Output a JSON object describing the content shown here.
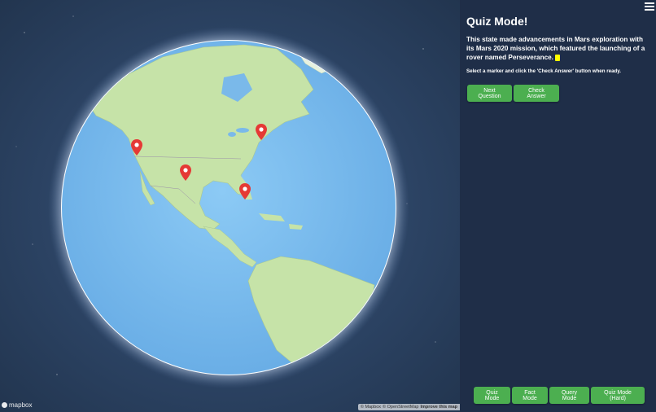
{
  "panel": {
    "title": "Quiz Mode!",
    "question": "This state made advancements in Mars exploration with its Mars 2020 mission, which featured the launching of a rover named Perseverance.",
    "instruction": "Select a marker and click the 'Check Answer' button when ready.",
    "next_label": "Next Question",
    "check_label": "Check Answer"
  },
  "modes": {
    "quiz": "Quiz Mode",
    "fact": "Fact Mode",
    "query": "Query Mode",
    "quiz_hard": "Quiz Mode (Hard)"
  },
  "map": {
    "logo_text": "mapbox",
    "attribution_1": "© Mapbox",
    "attribution_2": "© OpenStreetMap",
    "improve": "Improve this map"
  },
  "icons": {
    "menu": "hamburger-menu-icon",
    "marker": "map-pin-icon"
  },
  "colors": {
    "panel_bg": "#1f2e48",
    "button": "#4caf50",
    "marker": "#e53935",
    "ocean": "#7ab9ea",
    "land": "#c6e3a8"
  }
}
